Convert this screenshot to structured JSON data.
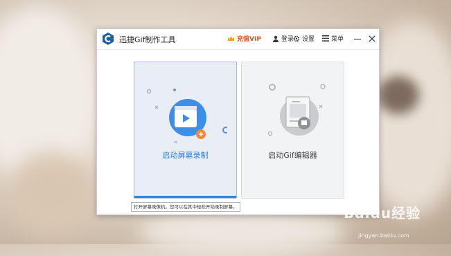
{
  "app": {
    "title": "迅捷Gif制作工具"
  },
  "titlebar": {
    "vip_label": "充值VIP",
    "login_label": "登录",
    "settings_label": "设置",
    "menu_label": "菜单"
  },
  "cards": [
    {
      "label": "启动屏幕录制",
      "icon": "screen-record-icon",
      "state": "hover"
    },
    {
      "label": "启动Gif编辑器",
      "icon": "gif-editor-icon",
      "state": "disabled"
    }
  ],
  "tooltip": {
    "text": "打开屏幕录像机，您可以在其中轻松开始录制屏幕。"
  },
  "watermark": {
    "logo": "Baidu经验",
    "url": "jingyan.baidu.com"
  },
  "colors": {
    "accent": "#2e86e0",
    "vip": "#e8511f",
    "brand_logo": "#1f5f9e"
  }
}
